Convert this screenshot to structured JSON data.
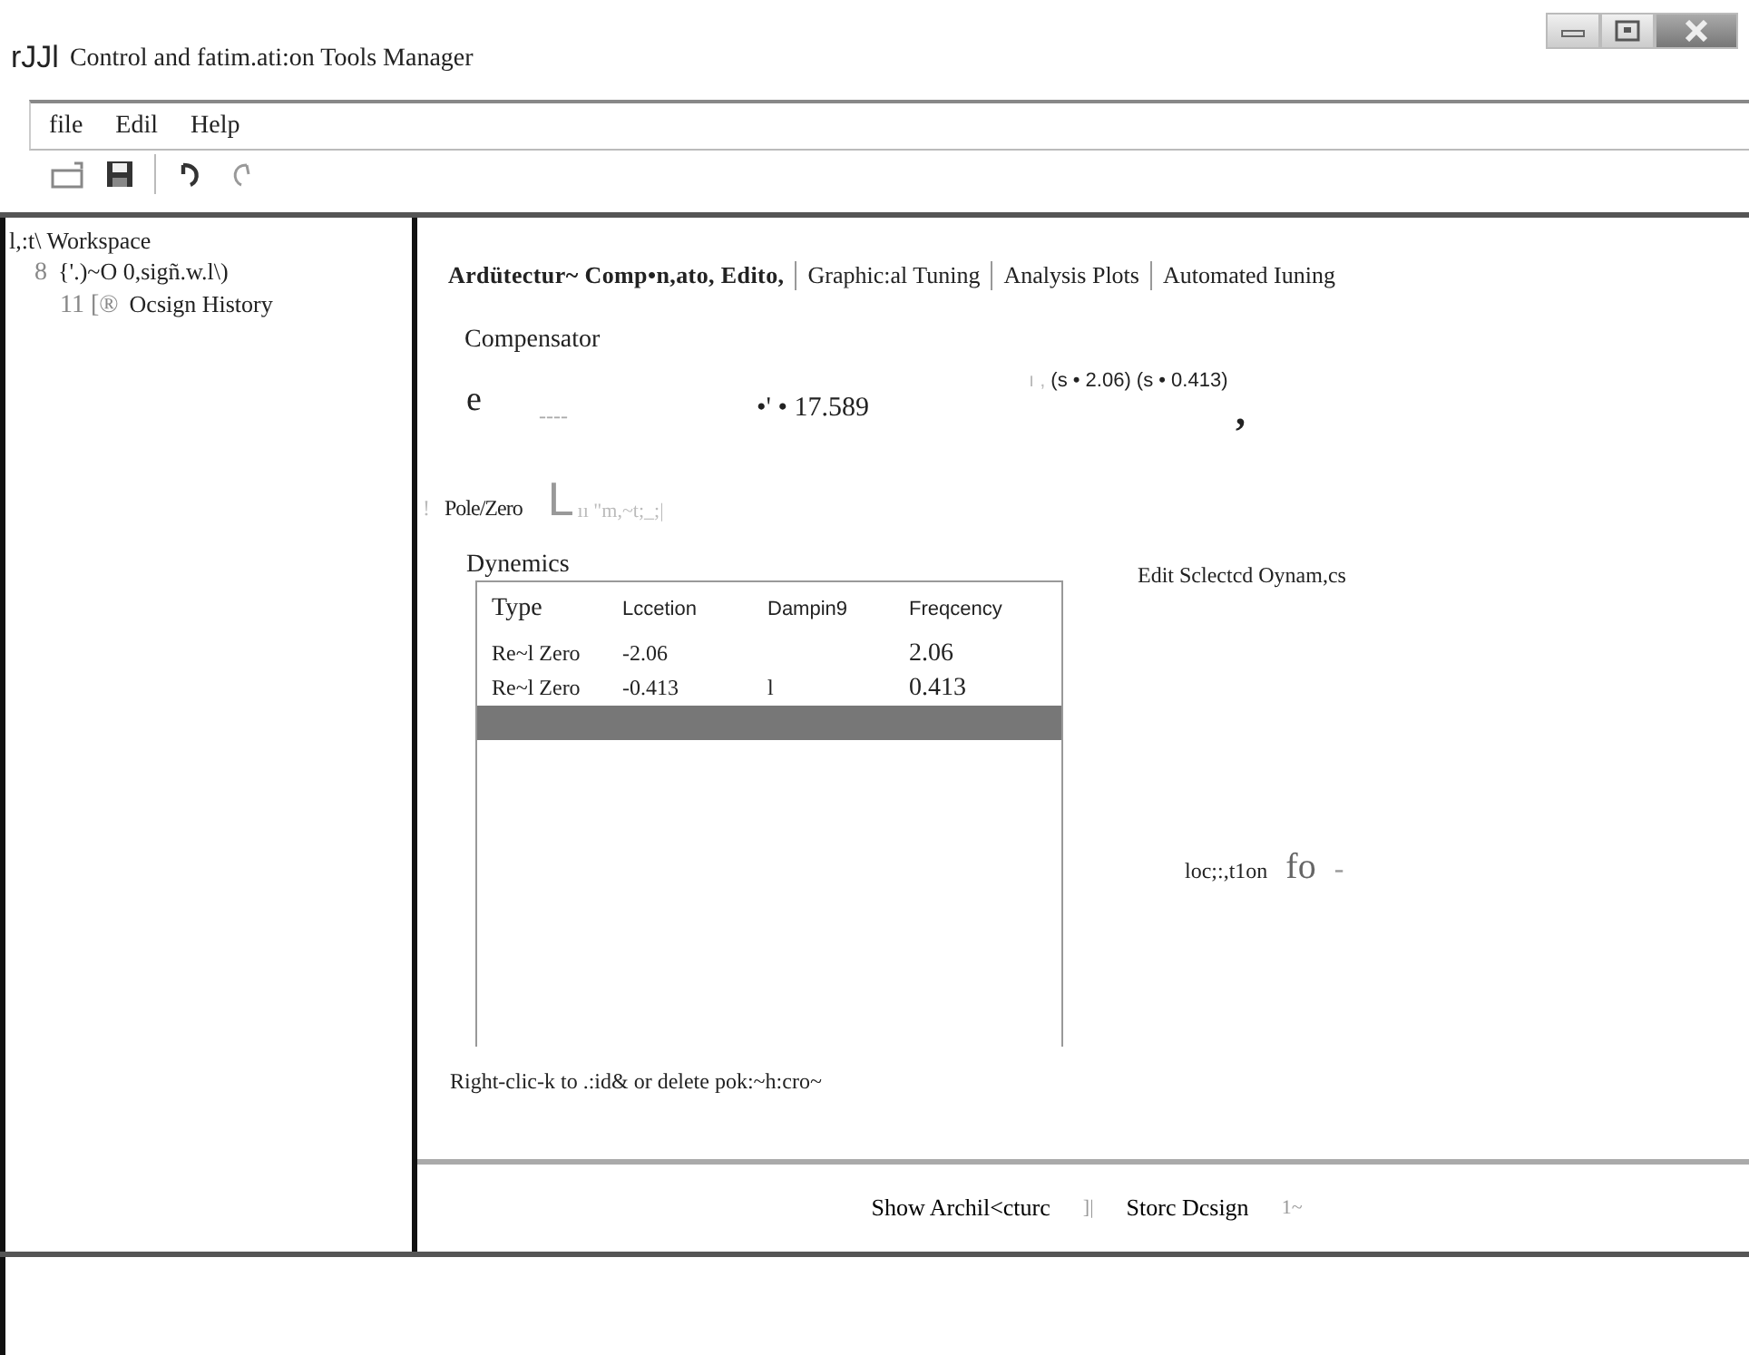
{
  "window": {
    "title_mark": "rJJl",
    "title": "Control and  fatim.ati:on Tools Manager"
  },
  "menu": [
    "file",
    "Edil",
    "Help"
  ],
  "tree": {
    "label": "l,:t\\ Workspace",
    "children": [
      {
        "label": "{'.)~O 0,sigñ.w.l\\)",
        "bullet": "8",
        "children": [
          {
            "label": "Ocsign   History",
            "bullet": "11 [®"
          }
        ]
      }
    ]
  },
  "tabs": [
    {
      "label": "Ardütectur~ Comp•n,ato, Edito,",
      "selected": true
    },
    {
      "label": "Graphic:al Tuning",
      "selected": false
    },
    {
      "label": "Analysis Plots",
      "selected": false
    },
    {
      "label": "Automated Iuning",
      "selected": false
    }
  ],
  "compensator": {
    "heading": "Compensator",
    "symbol": "e",
    "dashes": "----",
    "gain": "•' • 17.589",
    "tick": "ı ,",
    "factors": "(s • 2.06)  (s • 0.413)",
    "comma": ",",
    "mark": "!",
    "pole_zero": "Pole/Zero",
    "glyph": "L",
    "faded": "ıı \"m,~t;_;|"
  },
  "dynamics": {
    "heading": "Dynemics",
    "columns": [
      "Type",
      "Lccetion",
      "Dampin9",
      "Freqcency"
    ],
    "rows": [
      {
        "cells": [
          "Re~l  Zero",
          "-2.06",
          "",
          "2.06"
        ],
        "selected": false
      },
      {
        "cells": [
          "Re~l  Zero",
          "-0.413",
          "l",
          "0.413"
        ],
        "selected": false
      },
      {
        "cells": [
          "",
          "",
          "",
          ""
        ],
        "selected": true
      }
    ],
    "hint": "Right-clic-k  to .:id& or delete pok:~h:cro~"
  },
  "edit": {
    "heading": "Edit Sclectcd Oynam,cs",
    "label": "loc;:,t1on",
    "value": "fo",
    "dash": "-"
  },
  "footer": {
    "buttons": [
      "Show Archil<cturc",
      "Storc Dcsign"
    ],
    "marks": [
      "]|",
      "1~"
    ]
  }
}
